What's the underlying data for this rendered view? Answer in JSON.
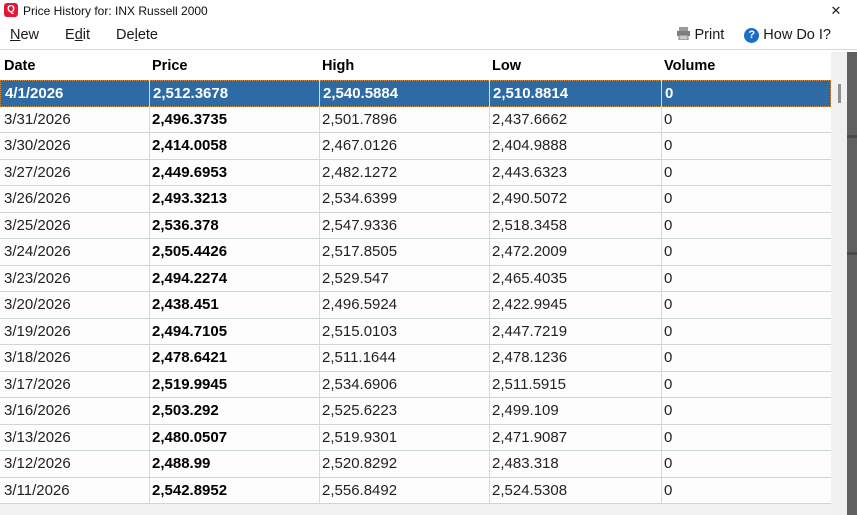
{
  "window": {
    "title": "Price History for: INX Russell 2000",
    "app_icon_glyph": "Q",
    "close_glyph": "✕"
  },
  "menu": {
    "items": [
      {
        "name": "new",
        "pre": "",
        "key": "N",
        "post": "ew"
      },
      {
        "name": "edit",
        "pre": "E",
        "key": "d",
        "post": "it"
      },
      {
        "name": "delete",
        "pre": "De",
        "key": "l",
        "post": "ete"
      }
    ],
    "print": {
      "pre": "",
      "key": "P",
      "post": "rint"
    },
    "how_do_i": "How Do I?",
    "help_icon_glyph": "?"
  },
  "table": {
    "columns": [
      "Date",
      "Price",
      "High",
      "Low",
      "Volume"
    ],
    "rows": [
      {
        "date": "4/1/2026",
        "price": "2,512.3678",
        "high": "2,540.5884",
        "low": "2,510.8814",
        "volume": "0",
        "selected": true
      },
      {
        "date": "3/31/2026",
        "price": "2,496.3735",
        "high": "2,501.7896",
        "low": "2,437.6662",
        "volume": "0",
        "selected": false
      },
      {
        "date": "3/30/2026",
        "price": "2,414.0058",
        "high": "2,467.0126",
        "low": "2,404.9888",
        "volume": "0",
        "selected": false
      },
      {
        "date": "3/27/2026",
        "price": "2,449.6953",
        "high": "2,482.1272",
        "low": "2,443.6323",
        "volume": "0",
        "selected": false
      },
      {
        "date": "3/26/2026",
        "price": "2,493.3213",
        "high": "2,534.6399",
        "low": "2,490.5072",
        "volume": "0",
        "selected": false
      },
      {
        "date": "3/25/2026",
        "price": "2,536.378",
        "high": "2,547.9336",
        "low": "2,518.3458",
        "volume": "0",
        "selected": false
      },
      {
        "date": "3/24/2026",
        "price": "2,505.4426",
        "high": "2,517.8505",
        "low": "2,472.2009",
        "volume": "0",
        "selected": false
      },
      {
        "date": "3/23/2026",
        "price": "2,494.2274",
        "high": "2,529.547",
        "low": "2,465.4035",
        "volume": "0",
        "selected": false
      },
      {
        "date": "3/20/2026",
        "price": "2,438.451",
        "high": "2,496.5924",
        "low": "2,422.9945",
        "volume": "0",
        "selected": false
      },
      {
        "date": "3/19/2026",
        "price": "2,494.7105",
        "high": "2,515.0103",
        "low": "2,447.7219",
        "volume": "0",
        "selected": false
      },
      {
        "date": "3/18/2026",
        "price": "2,478.6421",
        "high": "2,511.1644",
        "low": "2,478.1236",
        "volume": "0",
        "selected": false
      },
      {
        "date": "3/17/2026",
        "price": "2,519.9945",
        "high": "2,534.6906",
        "low": "2,511.5915",
        "volume": "0",
        "selected": false
      },
      {
        "date": "3/16/2026",
        "price": "2,503.292",
        "high": "2,525.6223",
        "low": "2,499.109",
        "volume": "0",
        "selected": false
      },
      {
        "date": "3/13/2026",
        "price": "2,480.0507",
        "high": "2,519.9301",
        "low": "2,471.9087",
        "volume": "0",
        "selected": false
      },
      {
        "date": "3/12/2026",
        "price": "2,488.99",
        "high": "2,520.8292",
        "low": "2,483.318",
        "volume": "0",
        "selected": false
      },
      {
        "date": "3/11/2026",
        "price": "2,542.8952",
        "high": "2,556.8492",
        "low": "2,524.5308",
        "volume": "0",
        "selected": false
      }
    ]
  },
  "colors": {
    "selected_row_bg": "#2e6ba4",
    "selection_focus_dotted": "#cc8f4d",
    "app_icon_red": "#e31837",
    "help_icon_blue": "#1a6fc4",
    "column_separator_pink": "#f5c9e0",
    "row_separator": "#ccd8d3"
  }
}
